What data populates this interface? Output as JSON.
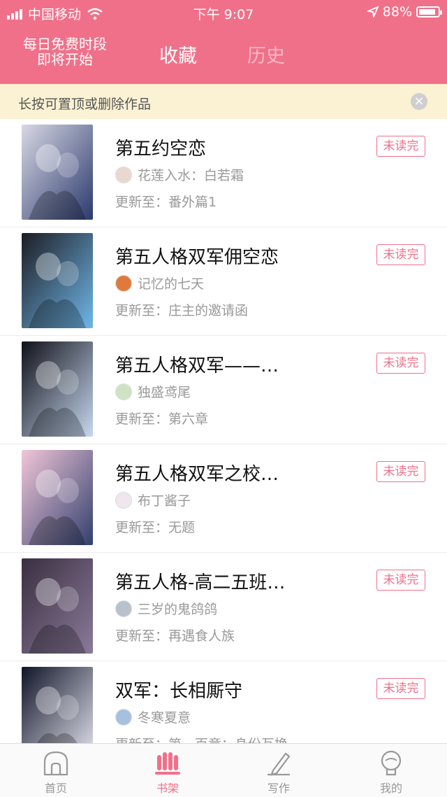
{
  "status_bar": {
    "carrier": "中国移动",
    "time": "下午 9:07",
    "battery": "88%",
    "battery_level": 0.88
  },
  "header": {
    "free_slot_line1": "每日免费时段",
    "free_slot_line2": "即将开始",
    "tab_favorites": "收藏",
    "tab_history": "历史"
  },
  "tip": {
    "text": "长按可置顶或删除作品",
    "close": "×"
  },
  "items": [
    {
      "title": "第五约空恋",
      "author": "花莲入水：白若霜",
      "update": "更新至：番外篇1",
      "badge": "未读完",
      "cover_colors": [
        "#d8d8e4",
        "#2b3a6e"
      ],
      "avatar_color": "#e8d8d0"
    },
    {
      "title": "第五人格双军佣空恋",
      "author": "记忆的七天",
      "update": "更新至：庄主的邀请函",
      "badge": "未读完",
      "cover_colors": [
        "#1c1c22",
        "#6fb6e8"
      ],
      "avatar_color": "#e07a3c"
    },
    {
      "title": "第五人格双军——…",
      "author": "独盛鸢尾",
      "update": "更新至：第六章",
      "badge": "未读完",
      "cover_colors": [
        "#101018",
        "#c6d8f0"
      ],
      "avatar_color": "#cfe3c4"
    },
    {
      "title": "第五人格双军之校…",
      "author": "布丁酱子",
      "update": "更新至：无题",
      "badge": "未读完",
      "cover_colors": [
        "#f2c6d8",
        "#31406e"
      ],
      "avatar_color": "#efe6f0"
    },
    {
      "title": "第五人格-高二五班…",
      "author": "三岁的鬼鸽鸽",
      "update": "更新至：再遇食人族",
      "badge": "未读完",
      "cover_colors": [
        "#3a2f40",
        "#8a7a9a"
      ],
      "avatar_color": "#b8c2cc"
    },
    {
      "title": "双军：长相厮守",
      "author": "冬寒夏意",
      "update": "更新至：第一百章：身份互换",
      "badge": "未读完",
      "cover_colors": [
        "#0f1428",
        "#e6e6f0"
      ],
      "avatar_color": "#a8c0e0"
    }
  ],
  "tabbar": {
    "home": "首页",
    "shelf": "书架",
    "write": "写作",
    "mine": "我的",
    "active_color": "#f0708a",
    "inactive_color": "#999999"
  }
}
